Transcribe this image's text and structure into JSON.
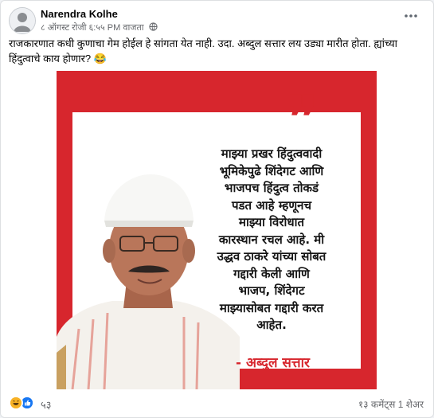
{
  "post": {
    "author": "Narendra Kolhe",
    "timestamp": "८ ऑगस्ट रोजी ६:५५ PM वाजता",
    "caption": "राजकारणात कधी कुणाचा गेम होईल हे सांगता येत नाही. उदा. अब्दुल सत्तार लय उड्या मारीत होता. ह्यांच्या हिंदुत्वाचे काय होणार? 😂",
    "privacy_icon": "globe-icon",
    "menu_icon": "more-options-icon"
  },
  "image": {
    "quote_mark": "❞",
    "quote_text": "माझ्या प्रखर हिंदुत्ववादी\nभूमिकेपुढे शिंदेगट आणि\nभाजपच हिंदुत्व तोकडं\nपडत आहे म्हणूनच\nमाझ्या विरोधात\nकारस्थान रचल आहे. मी\nउद्धव ठाकरे यांच्या सोबत\nगद्दारी केली आणि\nभाजप, शिंदेगट\nमाझ्यासोबत गद्दारी करत\nआहेत.",
    "attribution": "- अब्दुल सत्तार",
    "accent_color": "#d7262d"
  },
  "footer": {
    "reaction_icons": [
      "haha-icon",
      "like-icon"
    ],
    "reaction_count": "५३",
    "stats": "१३ कमेंट्स 1 शेअर"
  }
}
